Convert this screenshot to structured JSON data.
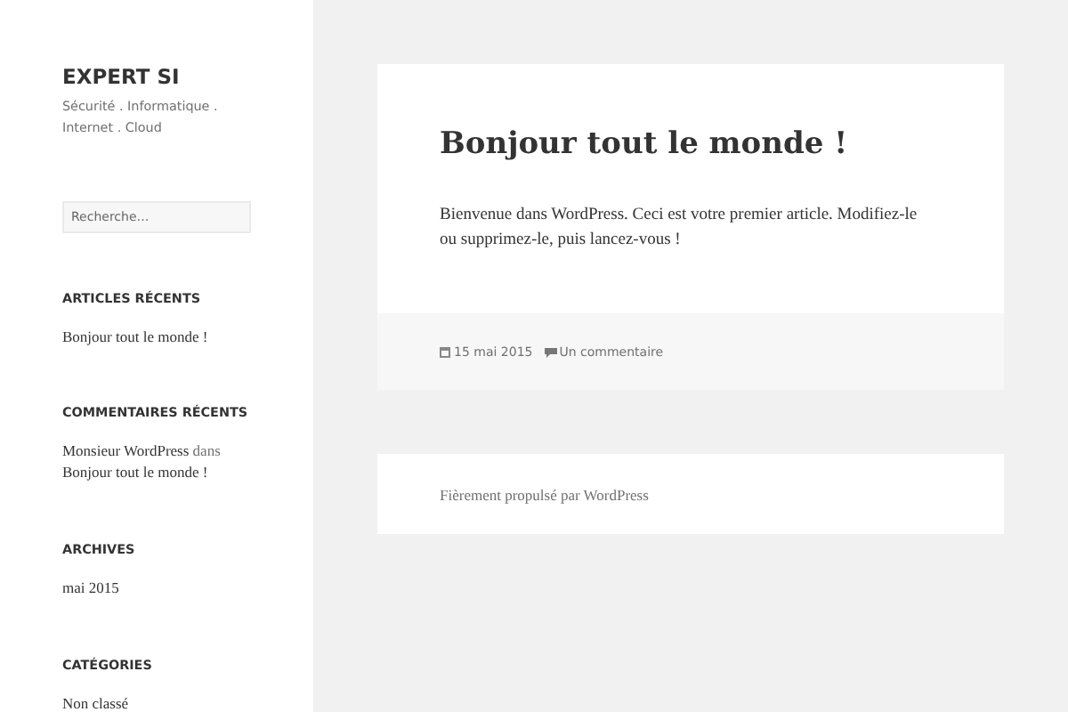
{
  "site": {
    "title": "EXPERT SI",
    "tagline": "Sécurité . Informatique . Internet . Cloud"
  },
  "search": {
    "placeholder": "Recherche…"
  },
  "widgets": [
    {
      "kind": "links",
      "title": "ARTICLES RÉCENTS",
      "items": [
        "Bonjour tout le monde !"
      ]
    },
    {
      "kind": "comments",
      "title": "COMMENTAIRES RÉCENTS",
      "items": [
        {
          "author": "Monsieur WordPress",
          "connector": "dans",
          "post": "Bonjour tout le monde !"
        }
      ]
    },
    {
      "kind": "links",
      "title": "ARCHIVES",
      "items": [
        "mai 2015"
      ]
    },
    {
      "kind": "links",
      "title": "CATÉGORIES",
      "items": [
        "Non classé"
      ]
    }
  ],
  "post": {
    "title": "Bonjour tout le monde !",
    "body": "Bienvenue dans WordPress. Ceci est votre premier article. Modifiez-le ou supprimez-le, puis lancez-vous !",
    "date": "15 mai 2015",
    "comments": "Un commentaire"
  },
  "footer": {
    "credit": "Fièrement propulsé par WordPress"
  }
}
